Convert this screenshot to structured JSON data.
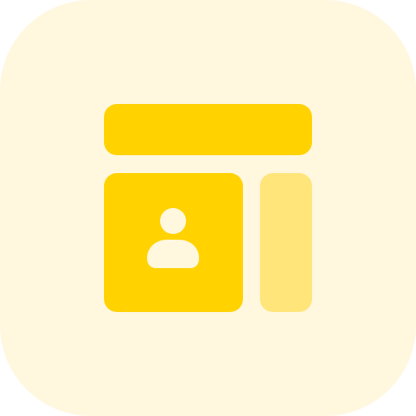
{
  "icon": {
    "name": "profile-layout-icon",
    "colors": {
      "background": "#FFF7DE",
      "primary": "#FFD200",
      "secondary": "#FFE57A",
      "glyph": "#FFF7DE"
    }
  }
}
